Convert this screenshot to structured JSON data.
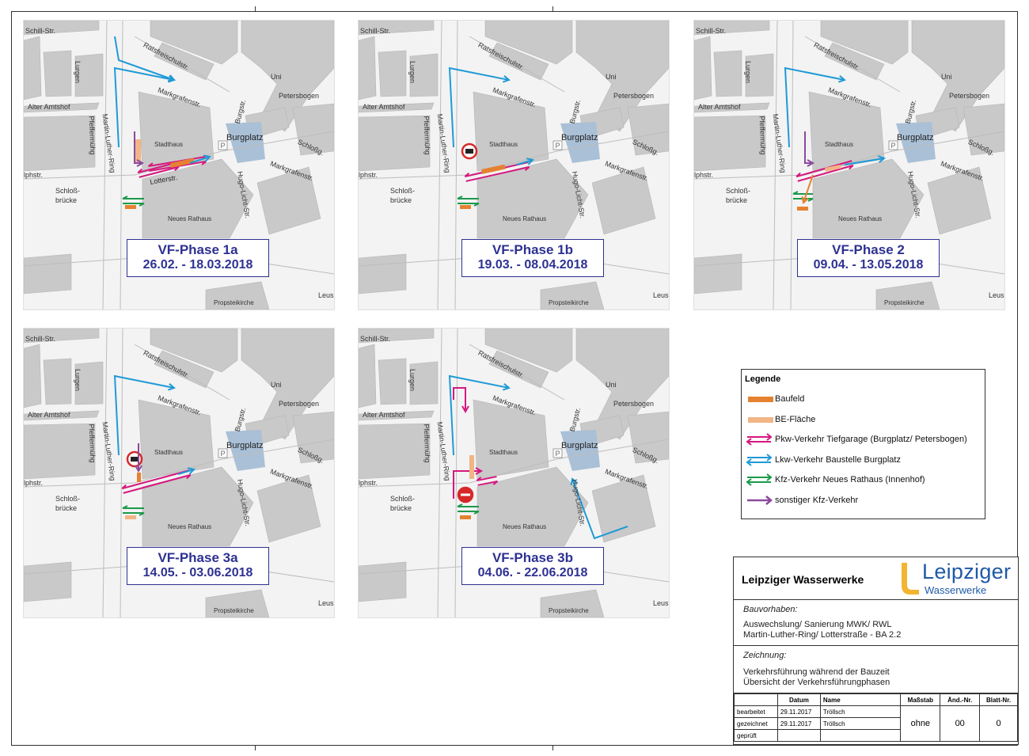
{
  "colors": {
    "baufeld": "#e58231",
    "be_flaeche": "#f2b585",
    "pkw": "#d6187e",
    "lkw": "#1f9ad6",
    "kfz_rathaus": "#1b9a4a",
    "sonstiger": "#8b4a9c",
    "title": "#2e3192",
    "burgplatz": "#aac0d6"
  },
  "streets": {
    "schill": "Schill-Str.",
    "ratsfreischul": "Ratsfreischulstr.",
    "markgrafen": "Markgrafenstr.",
    "alter_amtshof": "Alter Amtshof",
    "pfeffer": "Pfeffermühg",
    "martin_luther": "Martin-Luther-Ring",
    "burgstr": "Burgstr.",
    "petersbogen": "Petersbogen",
    "uni": "Uni",
    "schloss": "Schloßg.",
    "burgplatz": "Burgplatz",
    "stadthaus": "Stadthaus",
    "lotterstr": "Lotterstr.",
    "hugo_licht": "Hugo-Licht-Str.",
    "schloss_bruecke_1": "Schloß-",
    "schloss_bruecke_2": "brücke",
    "neues_rathaus": "Neues Rathaus",
    "propstei": "Propsteikirche",
    "leus": "Leus",
    "lphstr": "lphstr.",
    "lurgen": "Lurgen",
    "parking": "P"
  },
  "phases": [
    {
      "title": "VF-Phase 1a",
      "dates": "26.02. - 18.03.2018"
    },
    {
      "title": "VF-Phase 1b",
      "dates": "19.03. - 08.04.2018"
    },
    {
      "title": "VF-Phase 2",
      "dates": "09.04. - 13.05.2018"
    },
    {
      "title": "VF-Phase 3a",
      "dates": "14.05. - 03.06.2018"
    },
    {
      "title": "VF-Phase 3b",
      "dates": "04.06. - 22.06.2018"
    }
  ],
  "legend": {
    "title": "Legende",
    "items": [
      {
        "label": "Baufeld",
        "icon": "orange-bar"
      },
      {
        "label": "BE-Fläche",
        "icon": "light-orange-bar"
      },
      {
        "label": "Pkw-Verkehr Tiefgarage (Burgplatz/ Petersbogen)",
        "icon": "magenta-double-arrow"
      },
      {
        "label": "Lkw-Verkehr Baustelle Burgplatz",
        "icon": "blue-double-arrow"
      },
      {
        "label": "Kfz-Verkehr Neues Rathaus (Innenhof)",
        "icon": "green-double-arrow"
      },
      {
        "label": "sonstiger Kfz-Verkehr",
        "icon": "purple-arrow"
      }
    ]
  },
  "title_block": {
    "company": "Leipziger Wasserwerke",
    "logo_name": "Leipziger",
    "logo_sub": "Wasserwerke",
    "bauvorhaben_label": "Bauvorhaben:",
    "bauvorhaben_line1": "Auswechslung/ Sanierung MWK/ RWL",
    "bauvorhaben_line2": "Martin-Luther-Ring/ Lotterstraße - BA 2.2",
    "zeichnung_label": "Zeichnung:",
    "zeichnung_line1": "Verkehrsführung während der Bauzeit",
    "zeichnung_line2": "Übersicht der Verkehrsführungphasen",
    "headers": {
      "datum": "Datum",
      "name": "Name",
      "massstab": "Maßstab",
      "aend": "Änd.-Nr.",
      "blatt": "Blatt-Nr."
    },
    "rows": [
      {
        "role": "bearbeitet",
        "date": "29.11.2017",
        "name": "Tröllsch"
      },
      {
        "role": "gezeichnet",
        "date": "29.11.2017",
        "name": "Tröllsch"
      },
      {
        "role": "geprüft",
        "date": "",
        "name": ""
      }
    ],
    "massstab": "ohne",
    "aend_nr": "00",
    "blatt_nr": "0"
  }
}
